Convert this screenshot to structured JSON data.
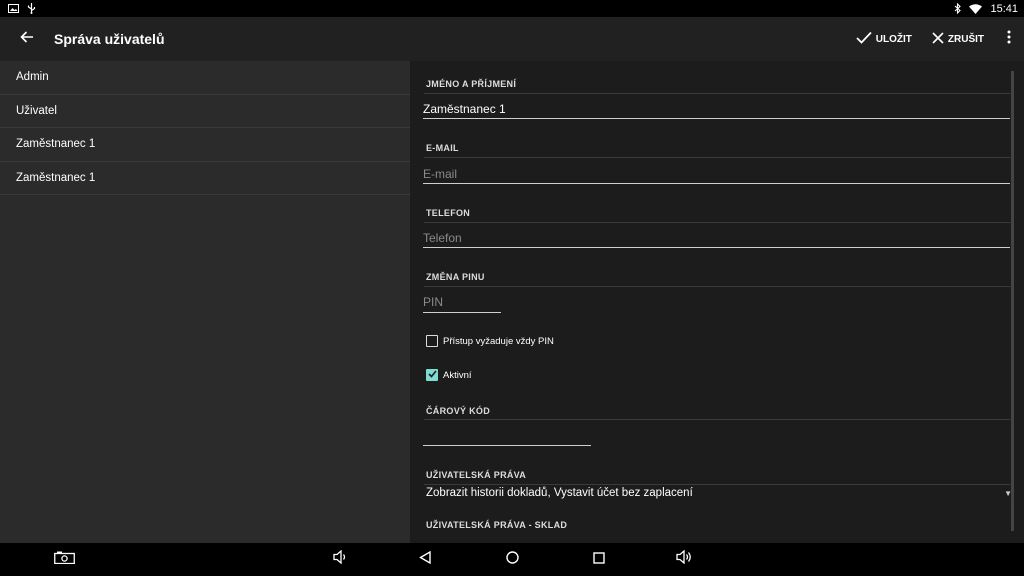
{
  "status_bar": {
    "left_icons": [
      "gallery-icon",
      "usb-icon"
    ],
    "right_icons": [
      "bluetooth-icon",
      "wifi-icon"
    ],
    "time": "15:41"
  },
  "app_bar": {
    "title": "Správa uživatelů",
    "save_label": "ULOŽIT",
    "cancel_label": "ZRUŠIT"
  },
  "users": [
    {
      "name": "Admin"
    },
    {
      "name": "Uživatel"
    },
    {
      "name": "Zaměstnanec 1"
    },
    {
      "name": "Zaměstnanec 1"
    }
  ],
  "form": {
    "name": {
      "header": "JMÉNO A PŘÍJMENÍ",
      "value": "Zaměstnanec 1"
    },
    "email": {
      "header": "E-MAIL",
      "value": "",
      "placeholder": "E-mail"
    },
    "phone": {
      "header": "TELEFON",
      "value": "",
      "placeholder": "Telefon"
    },
    "pin": {
      "header": "ZMĚNA PINU",
      "value": "",
      "placeholder": "PIN"
    },
    "require_pin": {
      "label": "Přístup vyžaduje vždy PIN",
      "checked": false
    },
    "active": {
      "label": "Aktivní",
      "checked": true
    },
    "barcode": {
      "header": "ČÁROVÝ KÓD",
      "value": ""
    },
    "rights": {
      "header": "UŽIVATELSKÁ PRÁVA",
      "value": "Zobrazit historii dokladů, Vystavit účet bez zaplacení"
    },
    "stock_rights": {
      "header": "UŽIVATELSKÁ PRÁVA - SKLAD"
    }
  },
  "colors": {
    "app_bar": "#212121",
    "list_bg": "#2b2b2b",
    "form_bg": "#1c1c1c",
    "checkbox_accent": "#7fdcd0"
  },
  "nav_bar": {
    "icons": [
      "screenshot-icon",
      "volume-down-icon",
      "back-icon",
      "home-icon",
      "recents-icon",
      "volume-up-icon"
    ]
  }
}
